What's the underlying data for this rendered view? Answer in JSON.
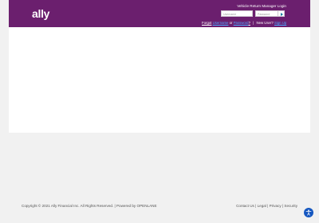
{
  "brand": {
    "logo_text": "ally",
    "header_color": "#6b1f6e"
  },
  "login": {
    "title": "Vehicle Return Manager Login",
    "username_placeholder": "Username",
    "password_placeholder": "Password",
    "forgot_prefix": "Forgot",
    "forgot_username": "Username",
    "or": "or",
    "forgot_password": "Password",
    "question_mark": "?",
    "divider": "|",
    "new_user_prefix": "New User?",
    "new_user_link": "Sign Up"
  },
  "footer": {
    "copyright": "Copyright © 2021 Ally Financial Inc. All Rights Reserved. | Powered by OPENLANE",
    "contact": "Contact Us",
    "sep1": " | ",
    "legal": "Legal",
    "sep2": " | ",
    "privacy": "Privacy",
    "sep3": " | ",
    "security": "Security"
  },
  "icons": {
    "go": "arrow-right-icon",
    "accessibility": "accessibility-icon"
  }
}
